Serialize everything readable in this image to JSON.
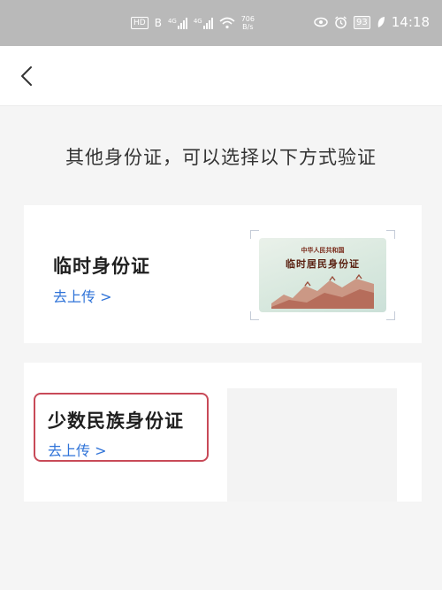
{
  "status_bar": {
    "hd_badge": "HD",
    "sim_label": "B",
    "network_1": "4G",
    "network_2": "4G",
    "speed_value": "706",
    "speed_unit": "B/s",
    "battery": "93",
    "time": "14:18"
  },
  "nav": {
    "back_icon": "chevron-left-icon"
  },
  "prompt": "其他身份证，可以选择以下方式验证",
  "cards": [
    {
      "title": "临时身份证",
      "action": "去上传 >",
      "sample_image": {
        "line1": "中华人民共和国",
        "line2": "临时居民身份证"
      }
    },
    {
      "title": "少数民族身份证",
      "action": "去上传 >"
    }
  ],
  "colors": {
    "link": "#2f73d8",
    "highlight": "#c84a58",
    "status_bar": "#b9b9b9"
  }
}
